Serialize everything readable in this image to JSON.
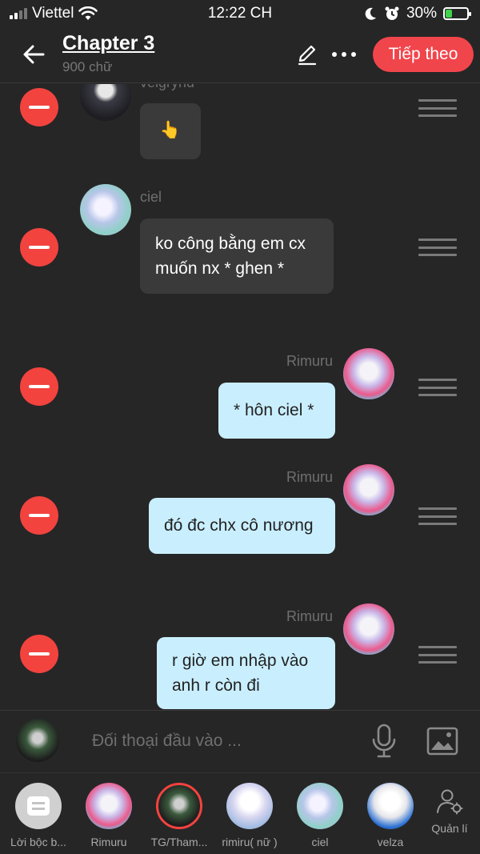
{
  "status_bar": {
    "carrier": "Viettel",
    "time": "12:22 CH",
    "battery": "30%",
    "battery_level": 0.3
  },
  "header": {
    "title": "Chapter 3",
    "word_count": "900 chữ",
    "next_label": "Tiếp theo"
  },
  "messages": [
    {
      "name": "veigrynd",
      "text": "👆",
      "side": "left"
    },
    {
      "name": "ciel",
      "text": "ko công bằng em cx muốn nx * ghen *",
      "side": "left"
    },
    {
      "name": "Rimuru",
      "text": "* hôn ciel *",
      "side": "right"
    },
    {
      "name": "Rimuru",
      "text": "đó đc chx cô nương",
      "side": "right"
    },
    {
      "name": "Rimuru",
      "text": "r giờ em nhập vào anh r còn đi",
      "side": "right"
    }
  ],
  "input": {
    "placeholder": "Đối thoại đầu vào ..."
  },
  "characters": [
    {
      "label": "Lời bộc b..."
    },
    {
      "label": "Rimuru"
    },
    {
      "label": "TG/Tham..."
    },
    {
      "label": "rimiru( nữ )"
    },
    {
      "label": "ciel"
    },
    {
      "label": "velza"
    }
  ],
  "manage_label": "Quản lí",
  "colors": {
    "accent": "#f1454c",
    "remove": "#f2433f",
    "bubble_right": "#c9efff",
    "bubble_left": "#3a3a3a",
    "background": "#262626"
  }
}
